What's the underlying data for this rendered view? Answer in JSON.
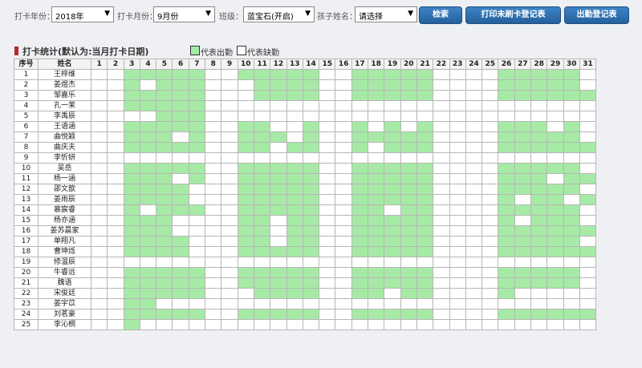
{
  "filters": {
    "year_label": "打卡年份：",
    "year_value": "2018年",
    "month_label": "打卡月份：",
    "month_value": "9月份",
    "class_label": "班级：",
    "class_value": "蓝宝石(开启)",
    "child_label": "孩子姓名：",
    "child_value": "请选择"
  },
  "buttons": {
    "search": "检索",
    "print_missing": "打印未刷卡登记表",
    "attendance_register": "出勤登记表"
  },
  "section": {
    "title": "打卡统计(默认为:当月打卡日期)",
    "legend_present": "代表出勤",
    "legend_absent": "代表缺勤"
  },
  "colors": {
    "present": "#a6eaa6",
    "absent": "#ffffff",
    "button": "#2f71b3",
    "title_bar": "#b22b2b"
  },
  "table": {
    "col_index": "序号",
    "col_name": "姓名",
    "days": [
      "1",
      "2",
      "3",
      "4",
      "5",
      "6",
      "7",
      "8",
      "9",
      "10",
      "11",
      "12",
      "13",
      "14",
      "15",
      "16",
      "17",
      "18",
      "19",
      "20",
      "21",
      "22",
      "23",
      "24",
      "25",
      "26",
      "27",
      "28",
      "29",
      "30",
      "31"
    ],
    "rows": [
      {
        "index": "1",
        "name": "王梓维",
        "att": "0011111001111100111110000111110"
      },
      {
        "index": "2",
        "name": "姜煜杰",
        "att": "0010111000111100111110000111110"
      },
      {
        "index": "3",
        "name": "邹嘉乐",
        "att": "0011111000111100111110000111111"
      },
      {
        "index": "4",
        "name": "孔一茉",
        "att": "0011111000000000000000000000000"
      },
      {
        "index": "5",
        "name": "李禹辰",
        "att": "0000111000000000000000000000000"
      },
      {
        "index": "6",
        "name": "王语涵",
        "att": "0011111001100100101010000111010"
      },
      {
        "index": "7",
        "name": "曲悦颖",
        "att": "0011101001110100111110000111110"
      },
      {
        "index": "8",
        "name": "曲庆夫",
        "att": "0011111001101100101110000111111"
      },
      {
        "index": "9",
        "name": "李忻妍",
        "att": "0000000000000000000000000000000"
      },
      {
        "index": "10",
        "name": "吴岳",
        "att": "0011111001111100111110000111110"
      },
      {
        "index": "11",
        "name": "杨一涵",
        "att": "0011101001111100111110000111011"
      },
      {
        "index": "12",
        "name": "邵文歆",
        "att": "0011110001111100111110000111110"
      },
      {
        "index": "13",
        "name": "姜雨辰",
        "att": "0011110001111100111110000101101"
      },
      {
        "index": "14",
        "name": "慕宸睿",
        "att": "0010111001111100110110000111110"
      },
      {
        "index": "15",
        "name": "杨亦涵",
        "att": "0011100001101100111110000101110"
      },
      {
        "index": "16",
        "name": "姜苏晨家",
        "att": "0011100001101100111110000111111"
      },
      {
        "index": "17",
        "name": "单翔凡",
        "att": "0011110001101100111110000111110"
      },
      {
        "index": "18",
        "name": "曹坤烁",
        "att": "0011110001111100111110000111111"
      },
      {
        "index": "19",
        "name": "修温辰",
        "att": "0000000000000000000000000000000"
      },
      {
        "index": "20",
        "name": "牛睿远",
        "att": "0011111001111100111110000111110"
      },
      {
        "index": "21",
        "name": "魏语",
        "att": "0011111001111100111110000111110"
      },
      {
        "index": "22",
        "name": "宋俊廷",
        "att": "0011111000111100110110000100000"
      },
      {
        "index": "23",
        "name": "姜宇苡",
        "att": "0011000000000000000000000000000"
      },
      {
        "index": "24",
        "name": "刘茗豪",
        "att": "0011111001111100111110000111111"
      },
      {
        "index": "25",
        "name": "李沁桐",
        "att": "0010000000000000000000000000000"
      }
    ]
  }
}
